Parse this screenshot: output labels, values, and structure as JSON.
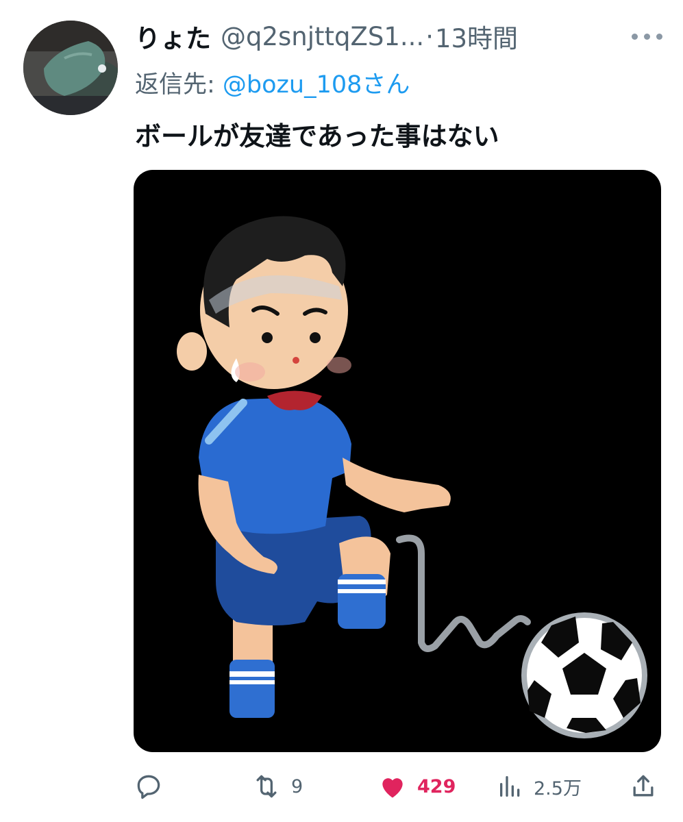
{
  "tweet": {
    "display_name": "りょた",
    "handle": "@q2snjttqZS1...",
    "separator": "·",
    "time": "13時間",
    "reply_prefix": "返信先: ",
    "reply_mention": "@bozu_108さん",
    "text": "ボールが友達であった事はない"
  },
  "actions": {
    "reply": {
      "icon": "reply-icon"
    },
    "retweet": {
      "icon": "retweet-icon",
      "count": "9"
    },
    "like": {
      "icon": "heart-icon",
      "count": "429",
      "color": "#e0245e"
    },
    "views": {
      "icon": "views-icon",
      "count": "2.5万"
    },
    "share": {
      "icon": "share-icon"
    }
  },
  "colors": {
    "primary_text": "#0f1419",
    "secondary_text": "#536471",
    "link": "#1d9bf0",
    "like": "#e0245e",
    "media_background": "#000000"
  }
}
